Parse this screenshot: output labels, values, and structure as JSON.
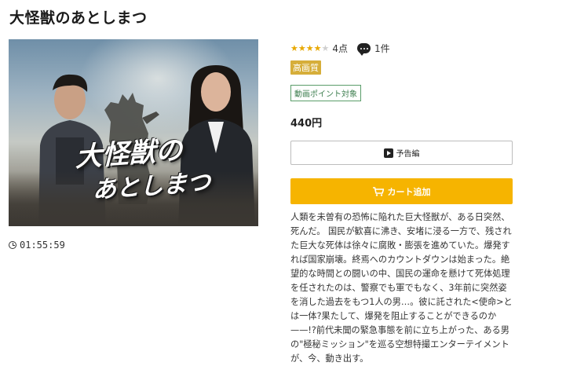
{
  "title": "大怪獣のあとしまつ",
  "poster": {
    "logo_line1": "大怪獣の",
    "logo_line2": "あとしまつ"
  },
  "duration": "01:55:59",
  "rating": {
    "stars": 4,
    "max_stars": 5,
    "points_label": "4点",
    "comments_label": "1件"
  },
  "badges": {
    "hd": "高画質",
    "point": "動画ポイント対象"
  },
  "price": "440円",
  "buttons": {
    "trailer": "予告編",
    "cart": "カート追加"
  },
  "description": "人類を未曽有の恐怖に陥れた巨大怪獣が、ある日突然、死んだ。 国民が歓喜に沸き、安堵に浸る一方で、残された巨大な死体は徐々に腐敗・膨張を進めていた。爆発すれば国家崩壊。終焉へのカウントダウンは始まった。絶望的な時間との闘いの中、国民の運命を懸けて死体処理を任されたのは、警察でも軍でもなく、3年前に突然姿を消した過去をもつ1人の男…。彼に託された<使命>とは一体?果たして、爆発を阻止することができるのか——!?前代未聞の緊急事態を前に立ち上がった、ある男の\"極秘ミッション\"を巡る空想特撮エンターテイメントが、今、動き出す。",
  "colors": {
    "star": "#e8a800",
    "hd_badge": "#d6ae3a",
    "point_badge": "#5a9d6a",
    "cart_button": "#f6b400"
  },
  "icons": {
    "comment": "speech-bubble-icon",
    "trailer": "play-icon",
    "cart": "cart-icon",
    "duration": "clock-icon"
  }
}
